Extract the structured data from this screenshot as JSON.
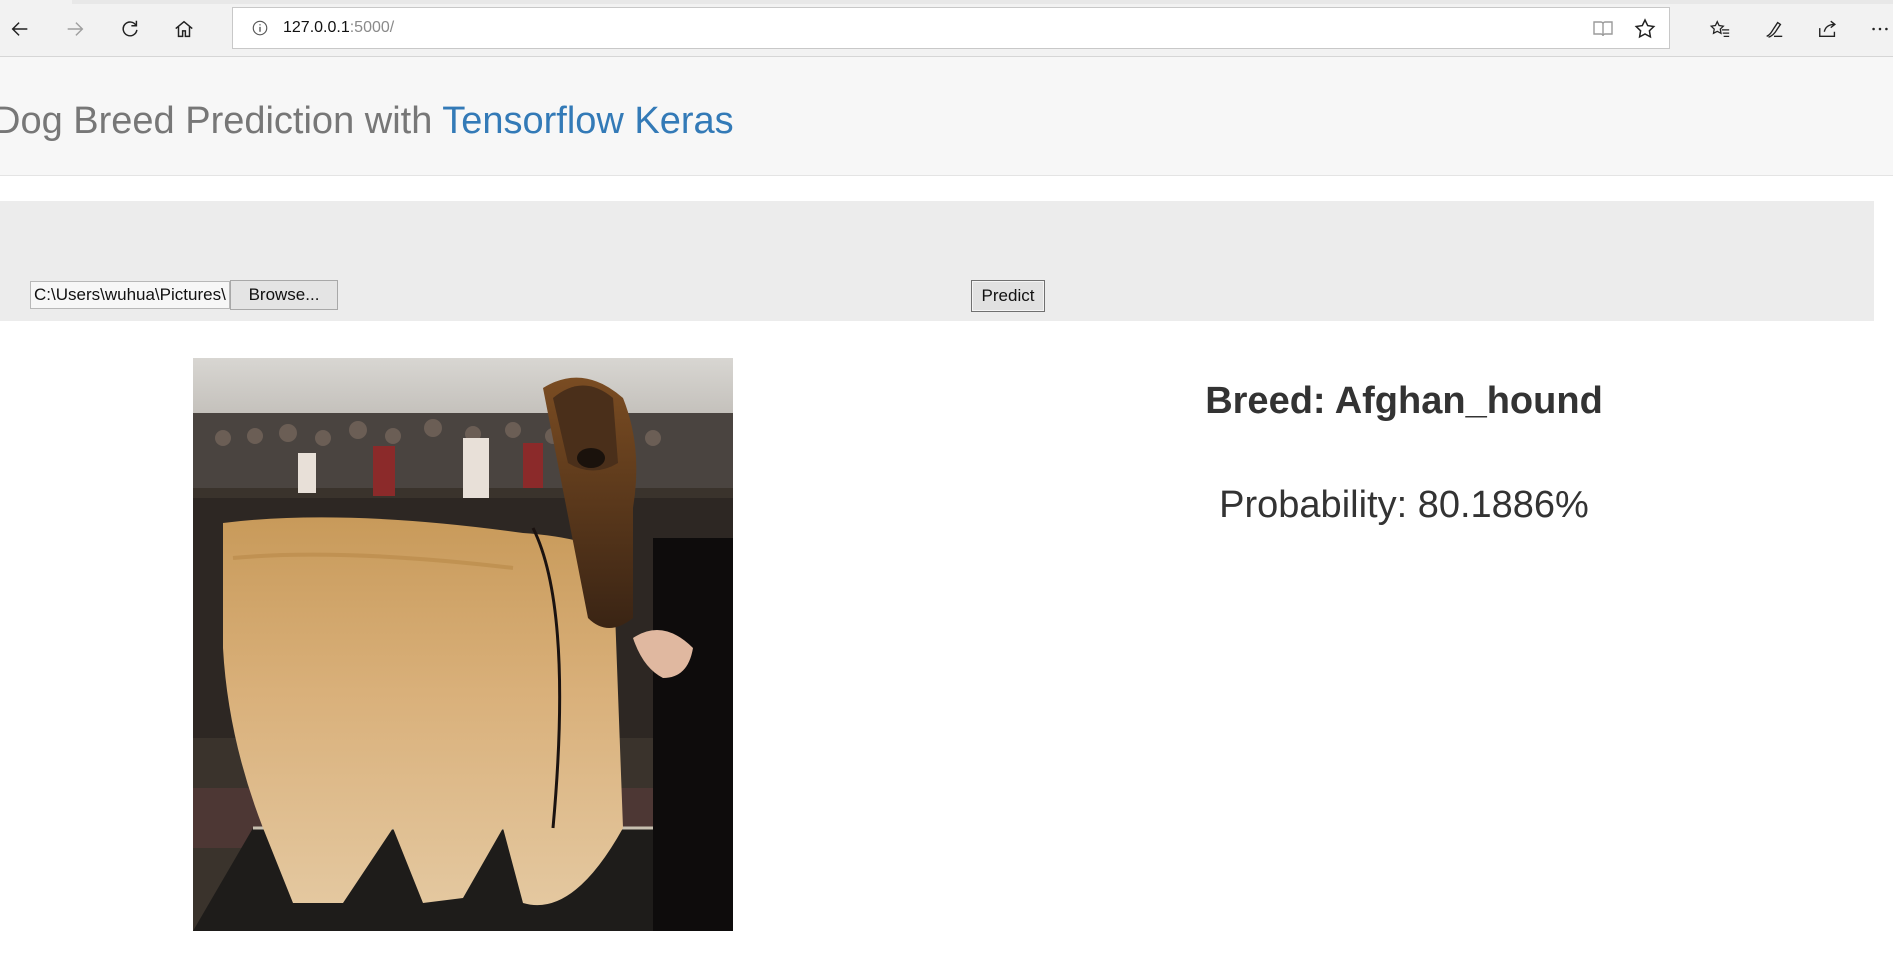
{
  "browser": {
    "url_host": "127.0.0.1",
    "url_path": ":5000/",
    "icons": {
      "back": "back-arrow-icon",
      "forward": "forward-arrow-icon",
      "refresh": "refresh-icon",
      "home": "home-icon",
      "site_info": "info-icon",
      "reading_view": "reading-view-icon",
      "favorite": "star-icon",
      "favorites_list": "favorites-icon",
      "notes": "pen-icon",
      "share": "share-icon",
      "more": "more-icon"
    }
  },
  "header": {
    "title_prefix": "Dog Breed Prediction with ",
    "title_link": "Tensorflow Keras"
  },
  "upload": {
    "file_value": "C:\\Users\\wuhua\\Pictures\\",
    "browse_label": "Browse...",
    "predict_label": "Predict"
  },
  "result": {
    "breed_text": "Breed: Afghan_hound",
    "probability_text": "Probability: 80.1886%"
  },
  "colors": {
    "link": "#337ab7",
    "header_text": "#777777",
    "result_text": "#333333"
  }
}
